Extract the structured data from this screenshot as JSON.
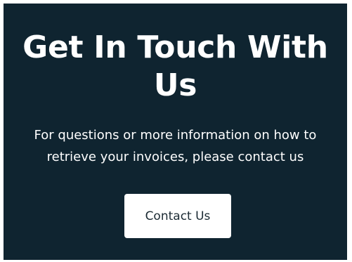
{
  "section": {
    "title": "Get In Touch With Us",
    "description": "For questions or more information on how to retrieve your invoices, please contact us",
    "cta_label": "Contact Us"
  },
  "colors": {
    "panel_background": "#0f2430",
    "text": "#ffffff",
    "button_background": "#ffffff",
    "button_text": "#1b2a33"
  }
}
